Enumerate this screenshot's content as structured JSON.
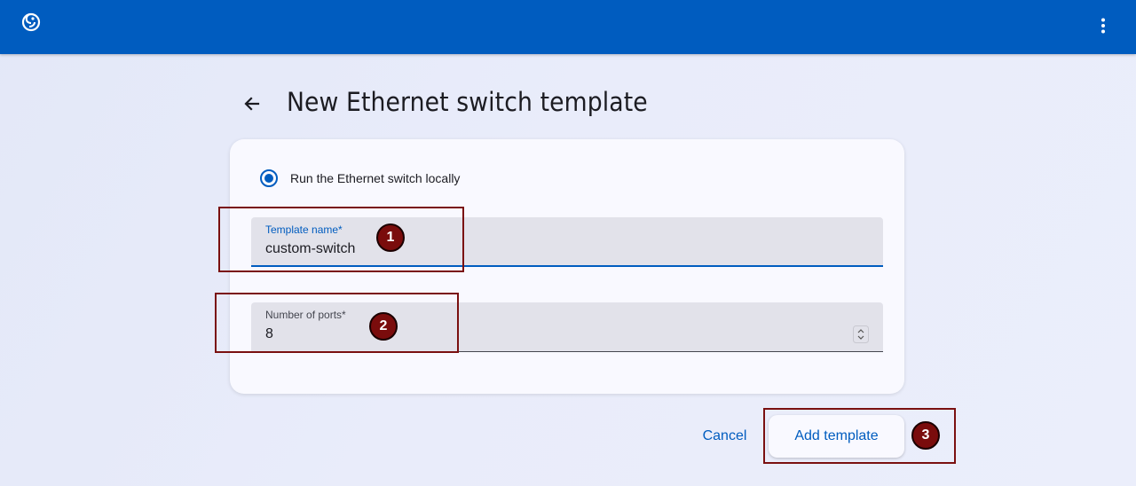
{
  "header": {
    "logo_icon": "gns3-logo-icon",
    "menu_icon": "more-vert-icon",
    "color": "#005cbf"
  },
  "page": {
    "back_icon": "arrow-back-icon",
    "title": "New Ethernet switch template"
  },
  "form": {
    "radio_label": "Run the Ethernet switch locally",
    "radio_selected": true,
    "template_name": {
      "label": "Template name*",
      "value": "custom-switch"
    },
    "ports": {
      "label": "Number of ports*",
      "value": "8"
    }
  },
  "actions": {
    "cancel_label": "Cancel",
    "add_label": "Add template"
  },
  "annotations": [
    "1",
    "2",
    "3"
  ],
  "colors": {
    "accent": "#005cbf",
    "annotation": "#7a0c0c",
    "background": "#e8ebf9"
  }
}
